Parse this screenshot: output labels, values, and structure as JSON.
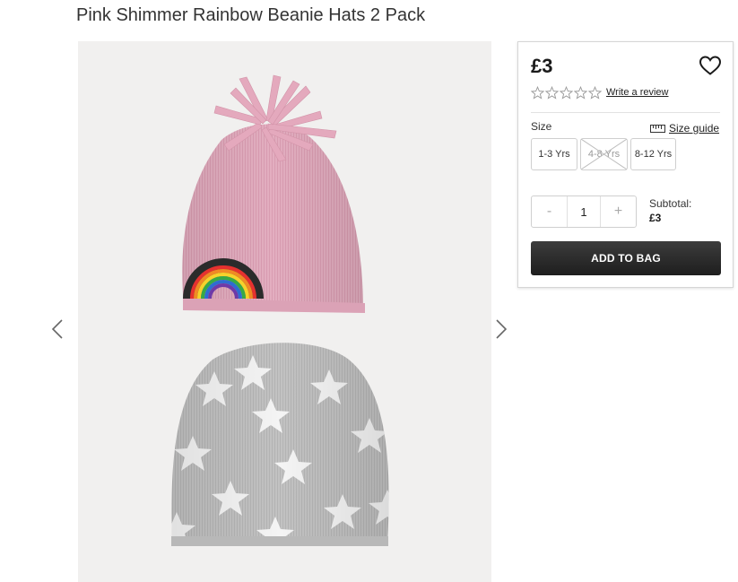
{
  "product": {
    "title": "Pink Shimmer Rainbow Beanie Hats 2 Pack",
    "image_alt": "Pink Shimmer Rainbow Beanie Hats 2 Pack"
  },
  "gallery": {
    "prev_icon": "chevron-left-icon",
    "next_icon": "chevron-right-icon"
  },
  "buy_box": {
    "price": "£3",
    "wishlist_icon": "heart-icon",
    "rating": {
      "stars_filled": 0,
      "stars_total": 5,
      "write_review_label": "Write a review"
    },
    "size": {
      "label": "Size",
      "size_guide_label": "Size guide",
      "size_guide_icon": "ruler-icon",
      "options": [
        {
          "label": "1-3 Yrs",
          "available": true
        },
        {
          "label": "4-8 Yrs",
          "available": false
        },
        {
          "label": "8-12 Yrs",
          "available": true
        }
      ]
    },
    "quantity": {
      "minus_label": "-",
      "value": "1",
      "plus_label": "+"
    },
    "subtotal": {
      "label": "Subtotal:",
      "value": "£3"
    },
    "add_to_bag_label": "ADD TO BAG"
  },
  "colors": {
    "hat_pink": "#e3aec0",
    "hat_grey": "#bebebe",
    "button_dark": "#2a2a2a",
    "background": "#f1f0ef"
  }
}
